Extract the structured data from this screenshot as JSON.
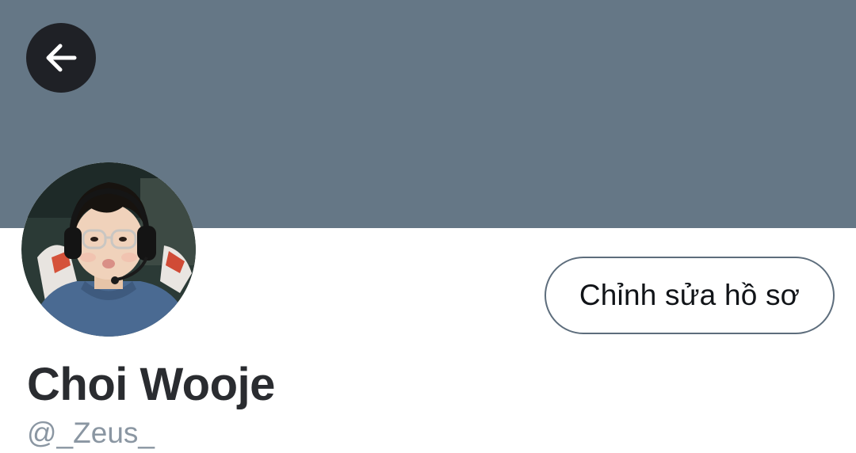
{
  "profile": {
    "banner_color": "#657786",
    "display_name": "Choi Wooje",
    "handle": "@_Zeus_",
    "edit_profile_label": "Chỉnh sửa hồ sơ"
  },
  "icons": {
    "back": "arrow-left-icon",
    "avatar": "profile-photo"
  },
  "colors": {
    "back_button_bg": "#1f2126",
    "button_border": "#5d6d7c",
    "handle_text": "#8a96a2"
  }
}
